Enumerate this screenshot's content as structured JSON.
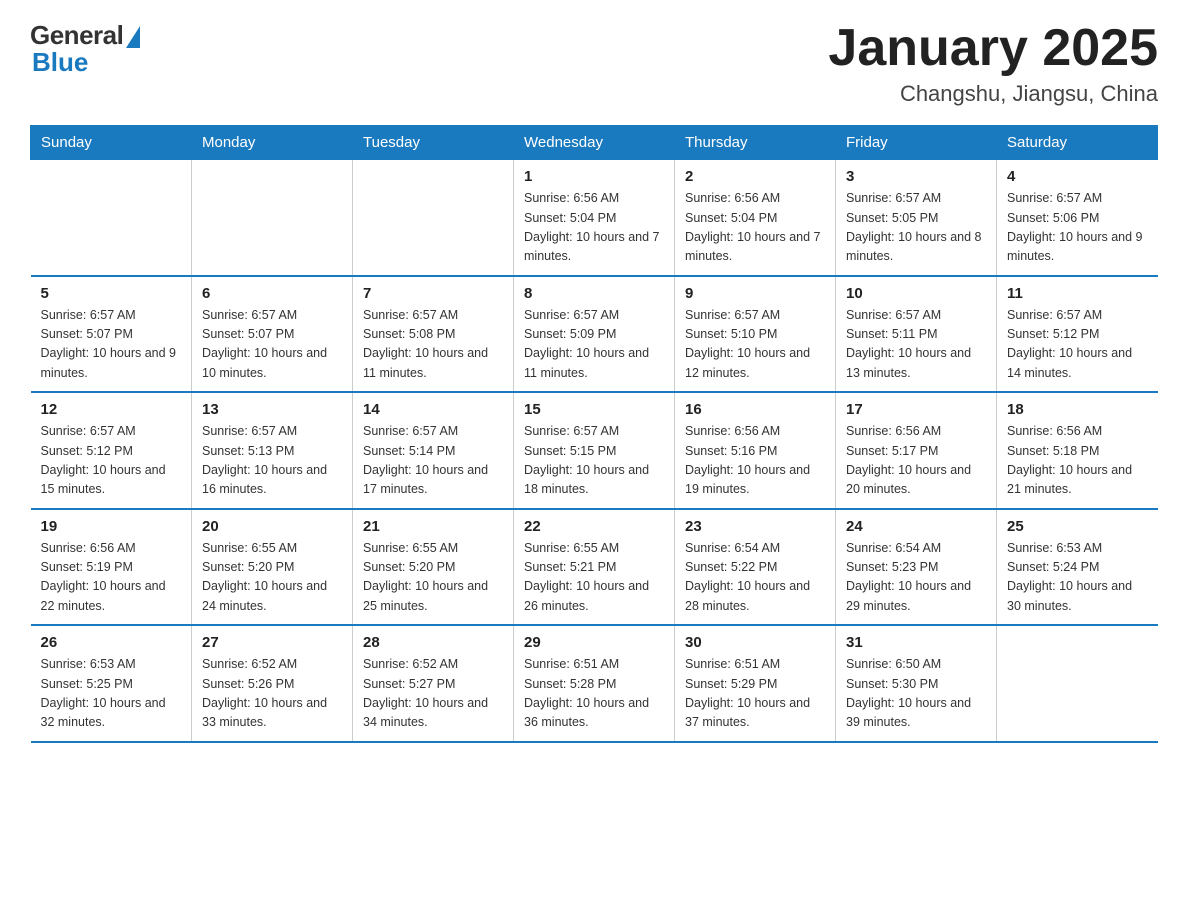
{
  "logo": {
    "general": "General",
    "blue": "Blue"
  },
  "header": {
    "month": "January 2025",
    "location": "Changshu, Jiangsu, China"
  },
  "days_of_week": [
    "Sunday",
    "Monday",
    "Tuesday",
    "Wednesday",
    "Thursday",
    "Friday",
    "Saturday"
  ],
  "weeks": [
    [
      {
        "day": "",
        "info": ""
      },
      {
        "day": "",
        "info": ""
      },
      {
        "day": "",
        "info": ""
      },
      {
        "day": "1",
        "info": "Sunrise: 6:56 AM\nSunset: 5:04 PM\nDaylight: 10 hours and 7 minutes."
      },
      {
        "day": "2",
        "info": "Sunrise: 6:56 AM\nSunset: 5:04 PM\nDaylight: 10 hours and 7 minutes."
      },
      {
        "day": "3",
        "info": "Sunrise: 6:57 AM\nSunset: 5:05 PM\nDaylight: 10 hours and 8 minutes."
      },
      {
        "day": "4",
        "info": "Sunrise: 6:57 AM\nSunset: 5:06 PM\nDaylight: 10 hours and 9 minutes."
      }
    ],
    [
      {
        "day": "5",
        "info": "Sunrise: 6:57 AM\nSunset: 5:07 PM\nDaylight: 10 hours and 9 minutes."
      },
      {
        "day": "6",
        "info": "Sunrise: 6:57 AM\nSunset: 5:07 PM\nDaylight: 10 hours and 10 minutes."
      },
      {
        "day": "7",
        "info": "Sunrise: 6:57 AM\nSunset: 5:08 PM\nDaylight: 10 hours and 11 minutes."
      },
      {
        "day": "8",
        "info": "Sunrise: 6:57 AM\nSunset: 5:09 PM\nDaylight: 10 hours and 11 minutes."
      },
      {
        "day": "9",
        "info": "Sunrise: 6:57 AM\nSunset: 5:10 PM\nDaylight: 10 hours and 12 minutes."
      },
      {
        "day": "10",
        "info": "Sunrise: 6:57 AM\nSunset: 5:11 PM\nDaylight: 10 hours and 13 minutes."
      },
      {
        "day": "11",
        "info": "Sunrise: 6:57 AM\nSunset: 5:12 PM\nDaylight: 10 hours and 14 minutes."
      }
    ],
    [
      {
        "day": "12",
        "info": "Sunrise: 6:57 AM\nSunset: 5:12 PM\nDaylight: 10 hours and 15 minutes."
      },
      {
        "day": "13",
        "info": "Sunrise: 6:57 AM\nSunset: 5:13 PM\nDaylight: 10 hours and 16 minutes."
      },
      {
        "day": "14",
        "info": "Sunrise: 6:57 AM\nSunset: 5:14 PM\nDaylight: 10 hours and 17 minutes."
      },
      {
        "day": "15",
        "info": "Sunrise: 6:57 AM\nSunset: 5:15 PM\nDaylight: 10 hours and 18 minutes."
      },
      {
        "day": "16",
        "info": "Sunrise: 6:56 AM\nSunset: 5:16 PM\nDaylight: 10 hours and 19 minutes."
      },
      {
        "day": "17",
        "info": "Sunrise: 6:56 AM\nSunset: 5:17 PM\nDaylight: 10 hours and 20 minutes."
      },
      {
        "day": "18",
        "info": "Sunrise: 6:56 AM\nSunset: 5:18 PM\nDaylight: 10 hours and 21 minutes."
      }
    ],
    [
      {
        "day": "19",
        "info": "Sunrise: 6:56 AM\nSunset: 5:19 PM\nDaylight: 10 hours and 22 minutes."
      },
      {
        "day": "20",
        "info": "Sunrise: 6:55 AM\nSunset: 5:20 PM\nDaylight: 10 hours and 24 minutes."
      },
      {
        "day": "21",
        "info": "Sunrise: 6:55 AM\nSunset: 5:20 PM\nDaylight: 10 hours and 25 minutes."
      },
      {
        "day": "22",
        "info": "Sunrise: 6:55 AM\nSunset: 5:21 PM\nDaylight: 10 hours and 26 minutes."
      },
      {
        "day": "23",
        "info": "Sunrise: 6:54 AM\nSunset: 5:22 PM\nDaylight: 10 hours and 28 minutes."
      },
      {
        "day": "24",
        "info": "Sunrise: 6:54 AM\nSunset: 5:23 PM\nDaylight: 10 hours and 29 minutes."
      },
      {
        "day": "25",
        "info": "Sunrise: 6:53 AM\nSunset: 5:24 PM\nDaylight: 10 hours and 30 minutes."
      }
    ],
    [
      {
        "day": "26",
        "info": "Sunrise: 6:53 AM\nSunset: 5:25 PM\nDaylight: 10 hours and 32 minutes."
      },
      {
        "day": "27",
        "info": "Sunrise: 6:52 AM\nSunset: 5:26 PM\nDaylight: 10 hours and 33 minutes."
      },
      {
        "day": "28",
        "info": "Sunrise: 6:52 AM\nSunset: 5:27 PM\nDaylight: 10 hours and 34 minutes."
      },
      {
        "day": "29",
        "info": "Sunrise: 6:51 AM\nSunset: 5:28 PM\nDaylight: 10 hours and 36 minutes."
      },
      {
        "day": "30",
        "info": "Sunrise: 6:51 AM\nSunset: 5:29 PM\nDaylight: 10 hours and 37 minutes."
      },
      {
        "day": "31",
        "info": "Sunrise: 6:50 AM\nSunset: 5:30 PM\nDaylight: 10 hours and 39 minutes."
      },
      {
        "day": "",
        "info": ""
      }
    ]
  ]
}
